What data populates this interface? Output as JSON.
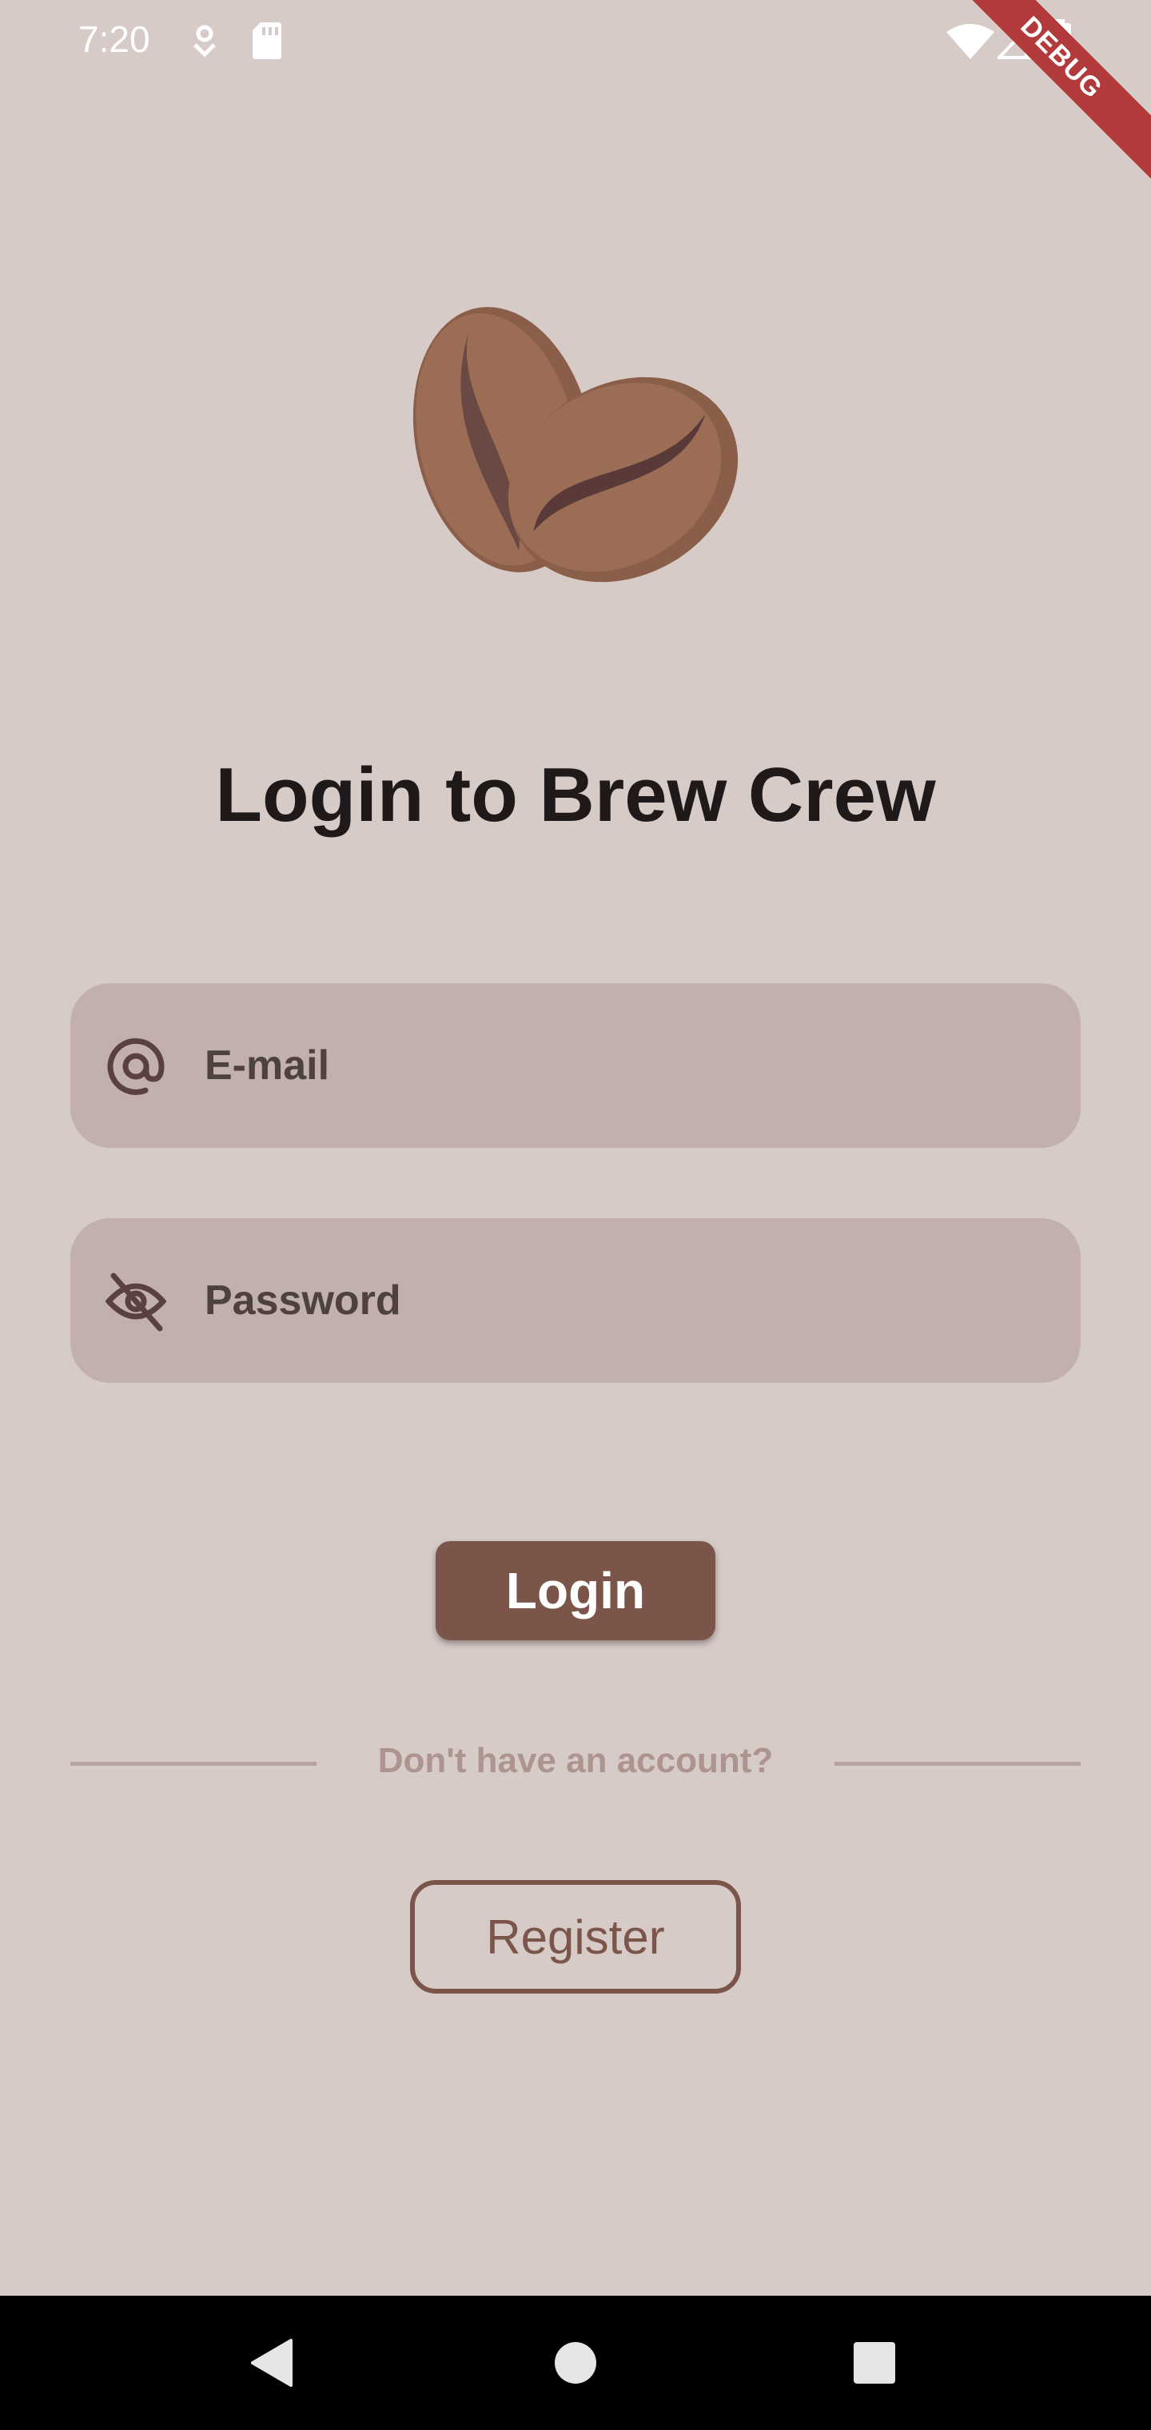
{
  "status_bar": {
    "time": "7:20",
    "icons": [
      "location-pin-icon",
      "sd-card-icon",
      "wifi-icon",
      "signal-icon",
      "battery-icon"
    ],
    "debug_banner": "DEBUG"
  },
  "logo": {
    "icon": "coffee-beans-icon"
  },
  "title": "Login to Brew Crew",
  "email_field": {
    "placeholder": "E-mail",
    "value": "",
    "icon": "at-sign-icon"
  },
  "password_field": {
    "placeholder": "Password",
    "value": "",
    "icon": "eye-off-icon"
  },
  "login_button": {
    "label": "Login"
  },
  "divider": {
    "text": "Don't have an account?"
  },
  "register_button": {
    "label": "Register"
  },
  "nav_bar": {
    "icons": [
      "back-icon",
      "home-icon",
      "recents-icon"
    ]
  },
  "colors": {
    "background": "#d7cbc8",
    "field_bg": "#c1b0ab",
    "primary": "#7b5549",
    "divider": "#b7a39e",
    "debug_banner": "#b23a3a"
  }
}
